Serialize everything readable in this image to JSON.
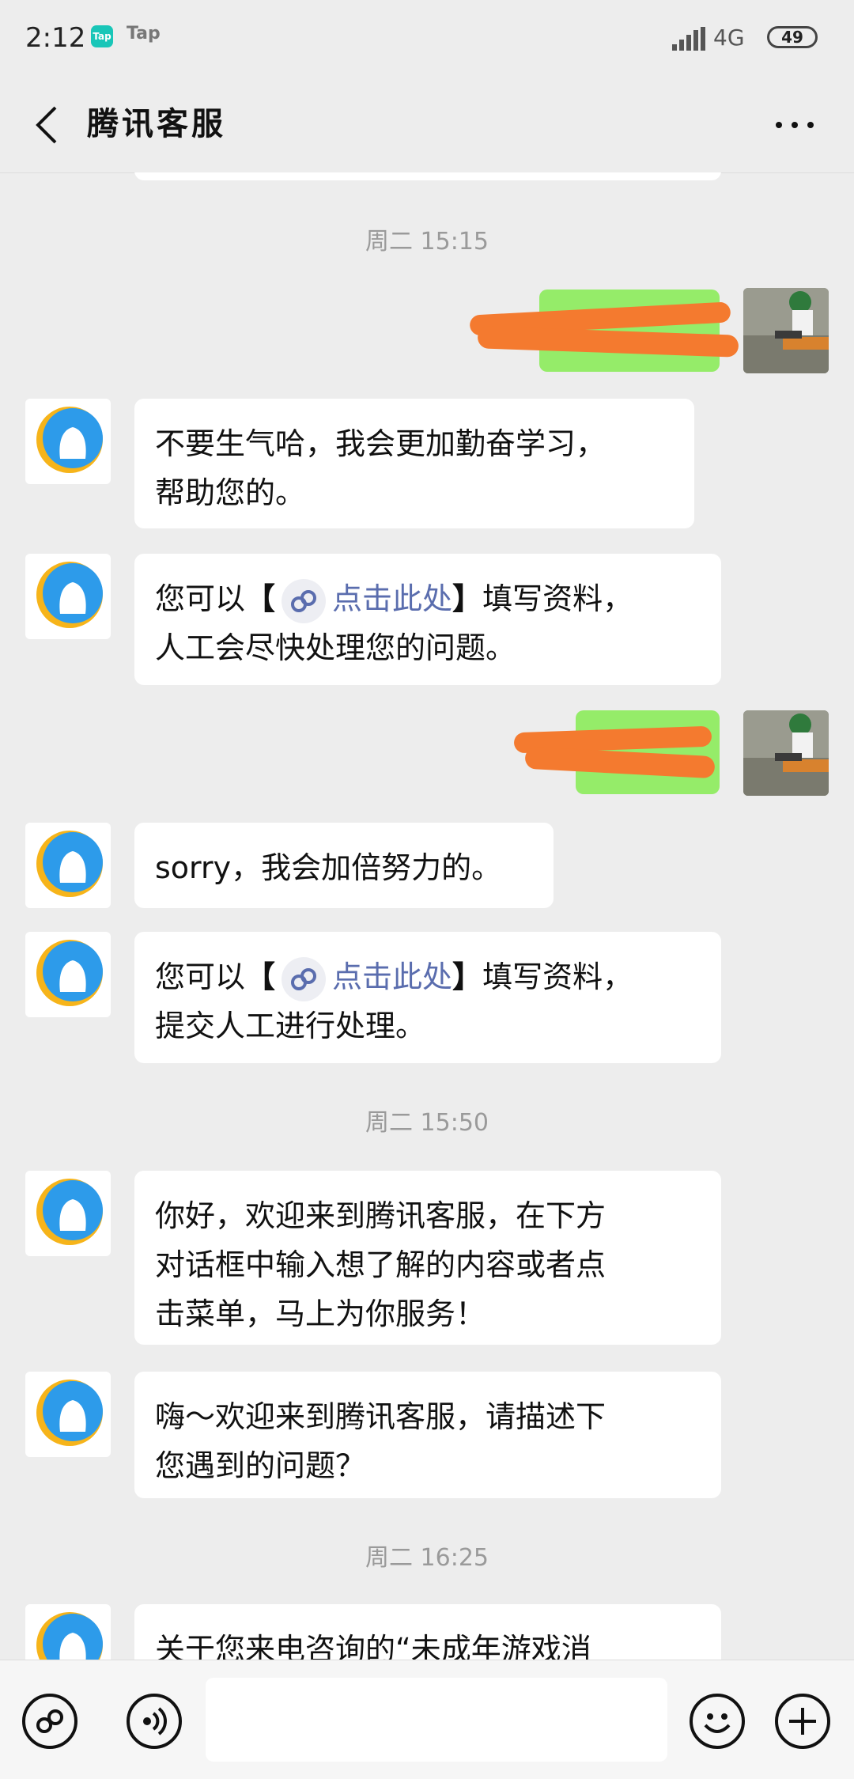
{
  "status_bar": {
    "time": "2:12",
    "app_badge": "Tap",
    "app_label": "Tap",
    "network": "4G",
    "battery": "49"
  },
  "header": {
    "title": "腾讯客服"
  },
  "timestamps": [
    "周二 15:15",
    "周二 15:50",
    "周二 16:25"
  ],
  "messages": {
    "m1": {
      "line1": "不要生气哈，我会更加勤奋学习，",
      "line2": "帮助您的。"
    },
    "m2": {
      "before": "您可以",
      "open": "【",
      "link": "点击此处",
      "close": "】",
      "after": "填写资料，",
      "line2": "人工会尽快处理您的问题。"
    },
    "m3": {
      "text": "sorry，我会加倍努力的。"
    },
    "m4": {
      "before": "您可以",
      "open": "【",
      "link": "点击此处",
      "close": "】",
      "after": "填写资料，",
      "line2": "提交人工进行处理。"
    },
    "m5": {
      "line1": "你好，欢迎来到腾讯客服，在下方",
      "line2": "对话框中输入想了解的内容或者点",
      "line3": "击菜单，马上为你服务！"
    },
    "m6": {
      "line1": "嗨～欢迎来到腾讯客服，请描述下",
      "line2": "您遇到的问题？"
    },
    "m7": {
      "line1": "关于您来电咨询的“未成年游戏消"
    }
  },
  "input": {
    "value": ""
  },
  "colors": {
    "background": "#ededed",
    "my_bubble": "#95ec69",
    "link": "#5a6dae",
    "redaction": "#f47a2f"
  },
  "icons": [
    "back-icon",
    "more-icon",
    "qq-service-icon",
    "mini-program-link-icon",
    "voice-icon",
    "emoji-icon",
    "plus-icon"
  ]
}
